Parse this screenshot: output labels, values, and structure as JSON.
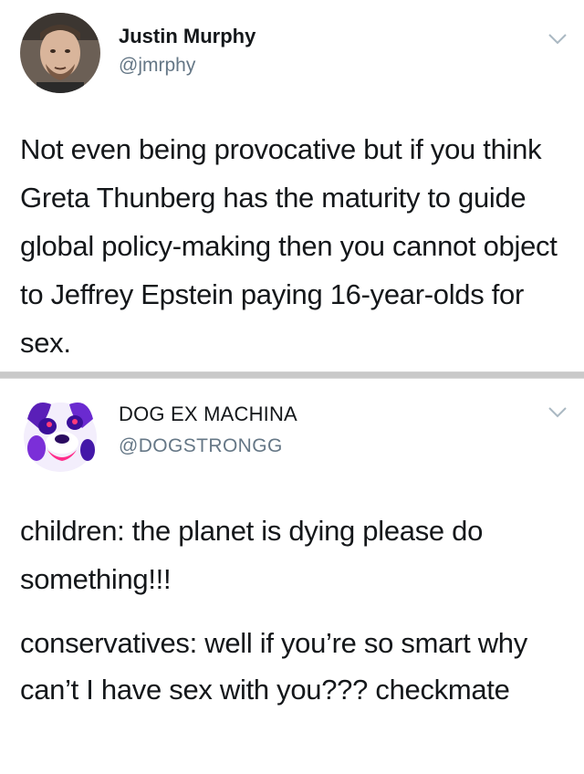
{
  "tweets": [
    {
      "display_name": "Justin Murphy",
      "handle": "@jmrphy",
      "avatar_icon": "person-photo-avatar",
      "menu_icon": "chevron-down-icon",
      "text": "Not even being provocative but if you think Greta Thunberg has the maturity to guide global policy-making then you cannot object to Jeffrey Epstein paying 16-year-olds for sex."
    },
    {
      "display_name": "DOG EX MACHINA",
      "handle": "@DOGSTRONGG",
      "avatar_icon": "dog-face-avatar",
      "menu_icon": "chevron-down-icon",
      "paragraphs": [
        "children: the planet is dying please do something!!!",
        "conservatives: well if you’re so smart why can’t I have sex with you??? checkmate"
      ]
    }
  ],
  "colors": {
    "name": "#14171a",
    "handle": "#657786",
    "chevron": "#aab8c2",
    "separator": "#c9c9c9"
  }
}
